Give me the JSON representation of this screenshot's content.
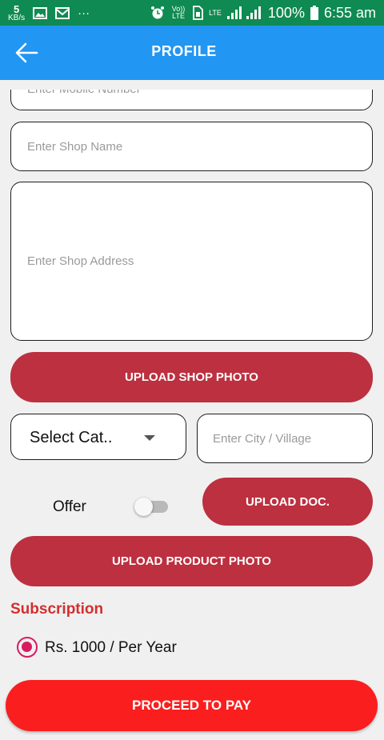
{
  "status_bar": {
    "speed_value": "5",
    "speed_unit": "KB/s",
    "more": "···",
    "volte": "Vo)) LTE",
    "lte": "LTE",
    "battery_percent": "100%",
    "time": "6:55 am"
  },
  "app_bar": {
    "title": "PROFILE"
  },
  "form": {
    "mobile_placeholder": "Enter Mobile Number",
    "shop_name_placeholder": "Enter Shop Name",
    "shop_address_placeholder": "Enter Shop Address",
    "upload_shop_photo": "UPLOAD SHOP PHOTO",
    "category_selected": "Select Cat..",
    "city_placeholder": "Enter City / Village",
    "offer_label": "Offer",
    "offer_enabled": false,
    "upload_doc": "UPLOAD DOC.",
    "upload_product_photo": "UPLOAD PRODUCT PHOTO"
  },
  "subscription": {
    "title": "Subscription",
    "option_label": "Rs. 1000 / Per Year",
    "option_selected": true
  },
  "proceed_button": "PROCEED TO PAY",
  "colors": {
    "status_bar": "#0f8a52",
    "app_bar": "#2196f3",
    "upload_button": "#bc3040",
    "pay_button": "#fa1e1e",
    "subscription_title": "#d32f2f",
    "radio": "#d81b60"
  }
}
